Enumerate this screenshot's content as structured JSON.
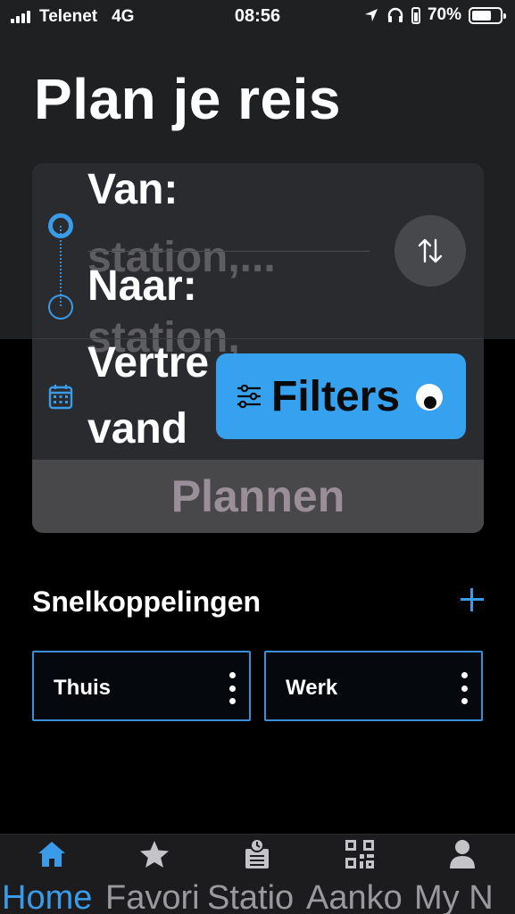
{
  "status_bar": {
    "carrier": "Telenet",
    "network": "4G",
    "time": "08:56",
    "battery": "70%",
    "battery_level": 0.7
  },
  "title": "Plan je reis",
  "planner": {
    "from_label": "Van:",
    "from_placeholder": "station,...",
    "to_label": "Naar:",
    "to_placeholder": "station,",
    "departure_label_line1": "Vertre",
    "departure_label_line2": "vand",
    "filters_label": "Filters",
    "plan_label": "Plannen"
  },
  "shortcuts": {
    "title": "Snelkoppelingen",
    "items": [
      {
        "label": "Thuis"
      },
      {
        "label": "Werk"
      }
    ]
  },
  "tabs": [
    {
      "label": "Home",
      "icon": "home-icon",
      "active": true
    },
    {
      "label": "Favori",
      "icon": "star-icon",
      "active": false
    },
    {
      "label": "Statio",
      "icon": "station-icon",
      "active": false
    },
    {
      "label": "Aanko",
      "icon": "qr-icon",
      "active": false
    },
    {
      "label": "My N",
      "icon": "user-icon",
      "active": false
    }
  ],
  "colors": {
    "accent": "#3a9be8",
    "filters_bg": "#36a1ef",
    "card_bg": "#2a2b2f",
    "header_bg": "#1f2022"
  }
}
